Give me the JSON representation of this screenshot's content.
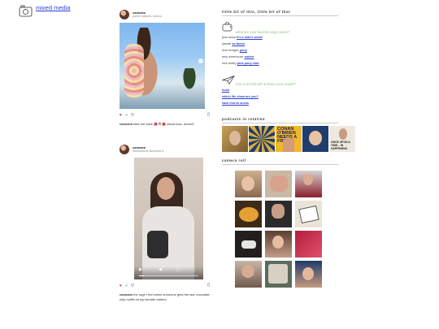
{
  "site": {
    "logo_text": "mixed media"
  },
  "posts": [
    {
      "handle": "camcam",
      "location": "puerto vallarta, mexico",
      "caption_user": "camcam",
      "caption_text": "take me back 🌺🌴🌺 /dead luau, drama*"
    },
    {
      "handle": "camcam",
      "location": "Stewardship Business #",
      "caption_user": "camcam",
      "caption_text": "the rage I feel when someone gets the last chocolate chip muffin at my favorite bakers."
    }
  ],
  "sidebar": {
    "section1_title": "little bit of this, little bit of that",
    "question1": "what are your favorite song covers?",
    "covers": [
      {
        "artist": "jess stone",
        "song": "it's a man's world"
      },
      {
        "artist": "lyanah",
        "song": "sx-factor"
      },
      {
        "artist": "leon bridges",
        "song": "pony"
      },
      {
        "artist": "amy winehouse",
        "song": "valerie"
      },
      {
        "artist": "nick astley",
        "song": "pink pony club"
      }
    ],
    "question2": "now it old school? & share your results?",
    "old_school_links": [
      "hush",
      "which life show are you?",
      "zack morris sucks"
    ],
    "section2_title": "podcasts in rotation",
    "podcasts": [
      {
        "title": ""
      },
      {
        "title": ""
      },
      {
        "title": "CONAN O'BRIEN NEEDS A FRIEND"
      },
      {
        "title": ""
      },
      {
        "title": "ONCE UPON A TIME... IN HAPPENING"
      }
    ],
    "section3_title": "camera roll"
  },
  "icons": {
    "logo": "camera-doodle-icon",
    "tv": "retro-tv-icon",
    "plane": "paper-plane-icon",
    "heart": "heart-icon",
    "comment": "comment-icon",
    "share": "share-icon",
    "save": "bookmark-icon"
  },
  "colors": {
    "link": "#2a3fd0",
    "question": "#8bbf7a",
    "heart": "#e0245e"
  }
}
